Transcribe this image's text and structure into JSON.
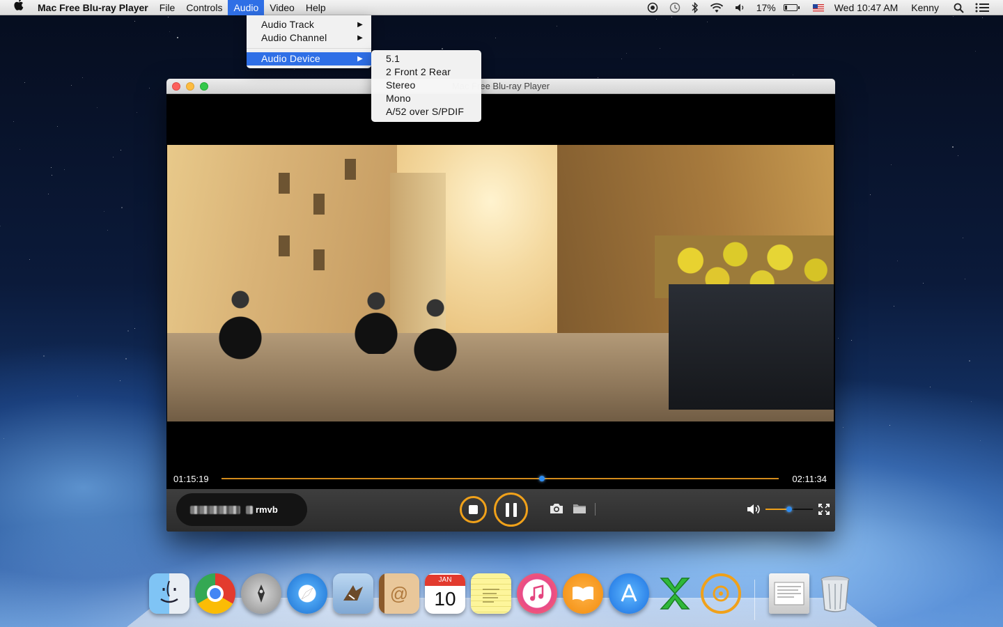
{
  "menubar": {
    "app_name": "Mac Free Blu-ray Player",
    "menus": [
      "File",
      "Controls",
      "Audio",
      "Video",
      "Help"
    ],
    "active_menu": "Audio",
    "status": {
      "battery": "17%",
      "clock": "Wed 10:47 AM",
      "user": "Kenny"
    }
  },
  "audio_menu": {
    "items": [
      "Audio Track",
      "Audio Channel",
      "Audio Device"
    ],
    "highlighted": "Audio Device"
  },
  "audio_device_submenu": {
    "items": [
      "5.1",
      "2 Front 2 Rear",
      "Stereo",
      "Mono",
      "A/52 over S/PDIF"
    ]
  },
  "window": {
    "title": "Mac Free Blu-ray Player"
  },
  "player": {
    "current_time": "01:15:19",
    "total_time": "02:11:34",
    "progress": 0.575,
    "file_ext": "rmvb",
    "volume": 0.5
  },
  "dock": {
    "apps": [
      "Finder",
      "Chrome",
      "Launchpad",
      "Safari",
      "Mail",
      "Contacts",
      "Calendar",
      "Notes",
      "iTunes",
      "iBooks",
      "App Store",
      "Excel",
      "Blu-ray Player",
      "Documents",
      "Trash"
    ],
    "calendar": {
      "month": "JAN",
      "day": "10"
    }
  },
  "colors": {
    "accent": "#f0a11a",
    "highlight": "#2f6fe6",
    "knob": "#2f8cf0"
  }
}
